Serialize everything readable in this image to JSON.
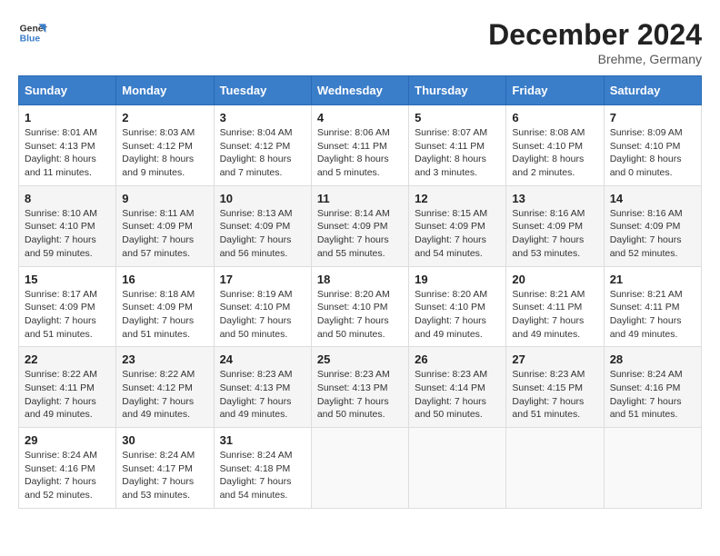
{
  "header": {
    "logo_line1": "General",
    "logo_line2": "Blue",
    "title": "December 2024",
    "subtitle": "Brehme, Germany"
  },
  "columns": [
    "Sunday",
    "Monday",
    "Tuesday",
    "Wednesday",
    "Thursday",
    "Friday",
    "Saturday"
  ],
  "weeks": [
    [
      {
        "day": "1",
        "info": "Sunrise: 8:01 AM\nSunset: 4:13 PM\nDaylight: 8 hours\nand 11 minutes."
      },
      {
        "day": "2",
        "info": "Sunrise: 8:03 AM\nSunset: 4:12 PM\nDaylight: 8 hours\nand 9 minutes."
      },
      {
        "day": "3",
        "info": "Sunrise: 8:04 AM\nSunset: 4:12 PM\nDaylight: 8 hours\nand 7 minutes."
      },
      {
        "day": "4",
        "info": "Sunrise: 8:06 AM\nSunset: 4:11 PM\nDaylight: 8 hours\nand 5 minutes."
      },
      {
        "day": "5",
        "info": "Sunrise: 8:07 AM\nSunset: 4:11 PM\nDaylight: 8 hours\nand 3 minutes."
      },
      {
        "day": "6",
        "info": "Sunrise: 8:08 AM\nSunset: 4:10 PM\nDaylight: 8 hours\nand 2 minutes."
      },
      {
        "day": "7",
        "info": "Sunrise: 8:09 AM\nSunset: 4:10 PM\nDaylight: 8 hours\nand 0 minutes."
      }
    ],
    [
      {
        "day": "8",
        "info": "Sunrise: 8:10 AM\nSunset: 4:10 PM\nDaylight: 7 hours\nand 59 minutes."
      },
      {
        "day": "9",
        "info": "Sunrise: 8:11 AM\nSunset: 4:09 PM\nDaylight: 7 hours\nand 57 minutes."
      },
      {
        "day": "10",
        "info": "Sunrise: 8:13 AM\nSunset: 4:09 PM\nDaylight: 7 hours\nand 56 minutes."
      },
      {
        "day": "11",
        "info": "Sunrise: 8:14 AM\nSunset: 4:09 PM\nDaylight: 7 hours\nand 55 minutes."
      },
      {
        "day": "12",
        "info": "Sunrise: 8:15 AM\nSunset: 4:09 PM\nDaylight: 7 hours\nand 54 minutes."
      },
      {
        "day": "13",
        "info": "Sunrise: 8:16 AM\nSunset: 4:09 PM\nDaylight: 7 hours\nand 53 minutes."
      },
      {
        "day": "14",
        "info": "Sunrise: 8:16 AM\nSunset: 4:09 PM\nDaylight: 7 hours\nand 52 minutes."
      }
    ],
    [
      {
        "day": "15",
        "info": "Sunrise: 8:17 AM\nSunset: 4:09 PM\nDaylight: 7 hours\nand 51 minutes."
      },
      {
        "day": "16",
        "info": "Sunrise: 8:18 AM\nSunset: 4:09 PM\nDaylight: 7 hours\nand 51 minutes."
      },
      {
        "day": "17",
        "info": "Sunrise: 8:19 AM\nSunset: 4:10 PM\nDaylight: 7 hours\nand 50 minutes."
      },
      {
        "day": "18",
        "info": "Sunrise: 8:20 AM\nSunset: 4:10 PM\nDaylight: 7 hours\nand 50 minutes."
      },
      {
        "day": "19",
        "info": "Sunrise: 8:20 AM\nSunset: 4:10 PM\nDaylight: 7 hours\nand 49 minutes."
      },
      {
        "day": "20",
        "info": "Sunrise: 8:21 AM\nSunset: 4:11 PM\nDaylight: 7 hours\nand 49 minutes."
      },
      {
        "day": "21",
        "info": "Sunrise: 8:21 AM\nSunset: 4:11 PM\nDaylight: 7 hours\nand 49 minutes."
      }
    ],
    [
      {
        "day": "22",
        "info": "Sunrise: 8:22 AM\nSunset: 4:11 PM\nDaylight: 7 hours\nand 49 minutes."
      },
      {
        "day": "23",
        "info": "Sunrise: 8:22 AM\nSunset: 4:12 PM\nDaylight: 7 hours\nand 49 minutes."
      },
      {
        "day": "24",
        "info": "Sunrise: 8:23 AM\nSunset: 4:13 PM\nDaylight: 7 hours\nand 49 minutes."
      },
      {
        "day": "25",
        "info": "Sunrise: 8:23 AM\nSunset: 4:13 PM\nDaylight: 7 hours\nand 50 minutes."
      },
      {
        "day": "26",
        "info": "Sunrise: 8:23 AM\nSunset: 4:14 PM\nDaylight: 7 hours\nand 50 minutes."
      },
      {
        "day": "27",
        "info": "Sunrise: 8:23 AM\nSunset: 4:15 PM\nDaylight: 7 hours\nand 51 minutes."
      },
      {
        "day": "28",
        "info": "Sunrise: 8:24 AM\nSunset: 4:16 PM\nDaylight: 7 hours\nand 51 minutes."
      }
    ],
    [
      {
        "day": "29",
        "info": "Sunrise: 8:24 AM\nSunset: 4:16 PM\nDaylight: 7 hours\nand 52 minutes."
      },
      {
        "day": "30",
        "info": "Sunrise: 8:24 AM\nSunset: 4:17 PM\nDaylight: 7 hours\nand 53 minutes."
      },
      {
        "day": "31",
        "info": "Sunrise: 8:24 AM\nSunset: 4:18 PM\nDaylight: 7 hours\nand 54 minutes."
      },
      null,
      null,
      null,
      null
    ]
  ]
}
